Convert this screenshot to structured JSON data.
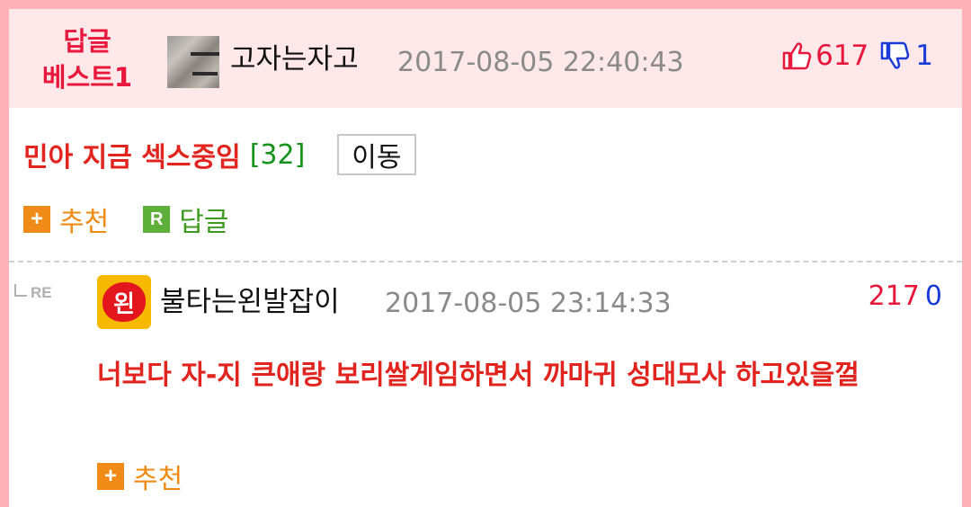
{
  "best_comment": {
    "badge_line1": "답글",
    "badge_line2": "베스트1",
    "author": "고자는자고",
    "datetime": "2017-08-05 22:40:43",
    "upvotes": "617",
    "downvotes": "1",
    "title": "민아 지금 섹스중임",
    "comment_count": "[32]",
    "move_button": "이동",
    "recommend_label": "추천",
    "reply_label": "답글",
    "reply_icon_letter": "R"
  },
  "reply": {
    "re_label": "RE",
    "avatar_text": "왼",
    "author": "불타는왼발잡이",
    "datetime": "2017-08-05 23:14:33",
    "upvotes": "217",
    "downvotes": "0",
    "body": "너보다 자-지 큰애랑 보리쌀게임하면서 까마귀 성대모사 하고있을껄",
    "recommend_label": "추천"
  },
  "icons": {
    "thumb_up": "thumbs-up-icon",
    "thumb_down": "thumbs-down-icon",
    "plus": "plus-icon",
    "reply": "reply-icon"
  },
  "colors": {
    "accent_red": "#e2241f",
    "badge_pink": "#e8173c",
    "header_bg": "#ffe8e9",
    "frame_pink": "#ffb3b8",
    "recommend_orange": "#ef8a12",
    "reply_green": "#3d9a1f",
    "downvote_blue": "#1a3bd8"
  }
}
